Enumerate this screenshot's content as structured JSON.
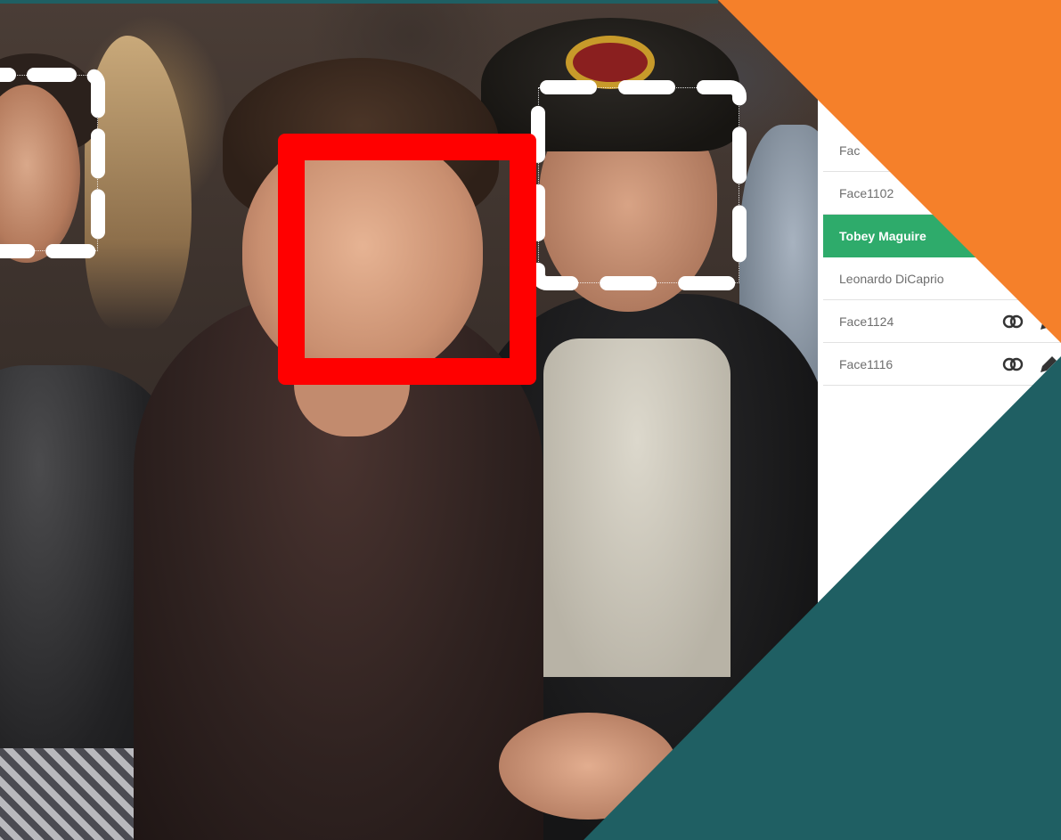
{
  "colors": {
    "accent_green": "#2eab6b",
    "selection_red": "#ff0000",
    "corner_orange": "#f5802a",
    "corner_teal": "#1f5f63",
    "panel_text": "#6e6e6e"
  },
  "faces_panel": {
    "items": [
      {
        "label": "Fac",
        "active": false,
        "has_actions": false
      },
      {
        "label": "Face1102",
        "active": false,
        "has_actions": false
      },
      {
        "label": "Tobey Maguire",
        "active": true,
        "has_actions": false
      },
      {
        "label": "Leonardo DiCaprio",
        "active": false,
        "has_actions": false
      },
      {
        "label": "Face1124",
        "active": false,
        "has_actions": true,
        "icons": [
          "merge-icon",
          "edit-icon"
        ]
      },
      {
        "label": "Face1116",
        "active": false,
        "has_actions": true,
        "icons": [
          "merge-icon",
          "edit-icon"
        ]
      }
    ]
  },
  "detections": [
    {
      "name": "selected",
      "style": "solid",
      "color": "#ff0000"
    },
    {
      "name": "unselected-left",
      "style": "dashed",
      "color": "#ffffff"
    },
    {
      "name": "unselected-right",
      "style": "dashed",
      "color": "#ffffff"
    }
  ]
}
